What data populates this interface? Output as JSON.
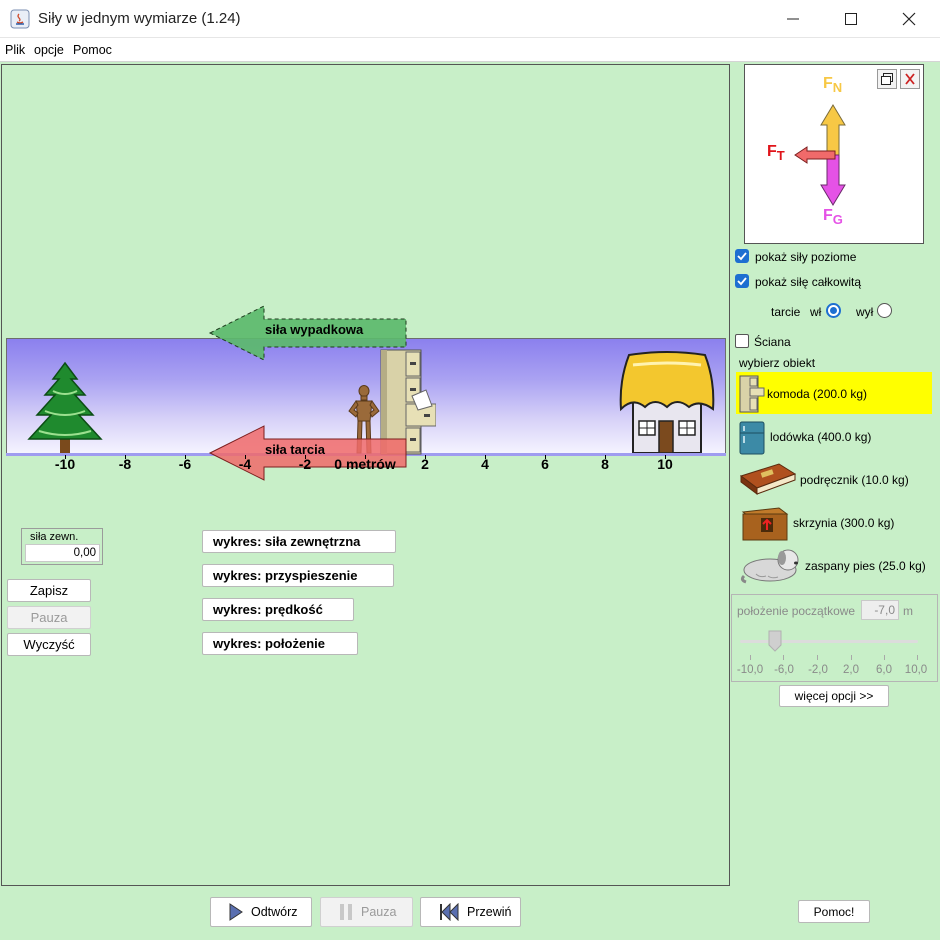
{
  "window": {
    "title": "Siły w jednym wymiarze (1.24)"
  },
  "menu": [
    "Plik",
    "opcje",
    "Pomoc"
  ],
  "scene": {
    "net_force_label": "siła wypadkowa",
    "friction_force_label": "siła tarcia",
    "axis_ticks": [
      "-10",
      "-8",
      "-6",
      "-4",
      "-2",
      "0 metrów",
      "2",
      "4",
      "6",
      "8",
      "10"
    ]
  },
  "applied_force": {
    "legend": "siła zewn.",
    "value": "0,00"
  },
  "left_buttons": {
    "record": "Zapisz",
    "pause": "Pauza",
    "clear": "Wyczyść"
  },
  "graph_buttons": [
    "wykres: siła zewnętrzna",
    "wykres: przyspieszenie",
    "wykres: prędkość",
    "wykres: położenie"
  ],
  "fbd": {
    "fn": "F",
    "fn_sub": "N",
    "ft": "F",
    "ft_sub": "T",
    "fg": "F",
    "fg_sub": "G"
  },
  "options": {
    "show_horizontal": "pokaż siły poziome",
    "show_total": "pokaż siłę całkowitą",
    "friction": "tarcie",
    "on": "wł",
    "off": "wył",
    "wall": "Ściana",
    "choose_object": "wybierz obiekt"
  },
  "objects": [
    "komoda (200.0 kg)",
    "lodówka (400.0 kg)",
    "podręcznik (10.0 kg)",
    "skrzynia (300.0 kg)",
    "zaspany pies (25.0 kg)"
  ],
  "position": {
    "label": "położenie początkowe",
    "value": "-7,0",
    "unit": "m",
    "slider_value": -7.0,
    "ticks": [
      "-10,0",
      "-6,0",
      "-2,0",
      "2,0",
      "6,0",
      "10,0"
    ]
  },
  "more_options": "więcej opcji >>",
  "playback": {
    "play": "Odtwórz",
    "pause": "Pauza",
    "rewind": "Przewiń"
  },
  "help": "Pomoc!",
  "colors": {
    "background": "#c8efc8",
    "selected_object": "#ffff00",
    "net_arrow": "#5cba6c",
    "friction_arrow": "#f06a6a",
    "normal_force": "#f7c845",
    "gravity_force": "#e552e6",
    "checkbox": "#1d6fd1"
  }
}
